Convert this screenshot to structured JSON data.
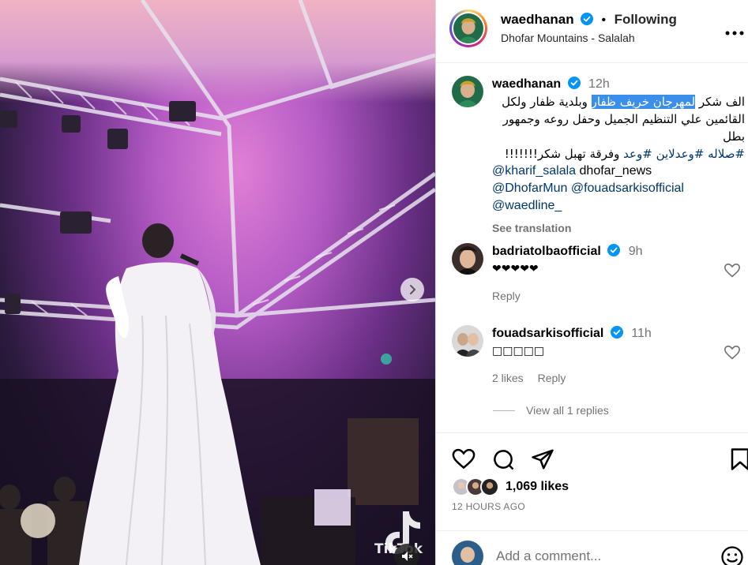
{
  "post": {
    "username": "waedhanan",
    "follow_status": "Following",
    "separator": "•",
    "location": "Dhofar Mountains - Salalah",
    "more_icon": "more-horizontal-icon"
  },
  "caption": {
    "username": "waedhanan",
    "time": "12h",
    "text_line1_pre": "الف شكر ",
    "text_line1_highlight": "لمهرجان خريف ظفار",
    "text_line1_post": " وبلدية ظفار ولكل",
    "text_line2": "القائمين علي التنظيم الجميل وحفل روعه وجمهور بطل",
    "text_line3_tags": "#صلاله #وعدلاين #وعد",
    "text_line3_text": " وفرقة تهبل شكر!!!!!!!",
    "mentions_line1_a": "@kharif_salala",
    "mentions_line1_b": " dhofar_news",
    "mentions_line2_a": "@DhofarMun",
    "mentions_line2_b": "@fouadsarkisofficial",
    "mentions_line3": "@waedline_",
    "see_translation": "See translation"
  },
  "comments": [
    {
      "username": "badriatolbaofficial",
      "time": "9h",
      "text": "❤❤❤❤❤",
      "likes": "",
      "reply": "Reply"
    },
    {
      "username": "fouadsarkisofficial",
      "time": "11h",
      "text": "□□□□□",
      "likes": "2 likes",
      "reply": "Reply"
    }
  ],
  "view_replies": "View all 1 replies",
  "actions": {
    "likes_count": "1,069 likes",
    "time_ago": "12 HOURS AGO"
  },
  "add_comment": {
    "placeholder": "Add a comment..."
  },
  "media": {
    "watermark": "TikTok"
  },
  "colors": {
    "verified": "#0095f6",
    "link": "#00376b",
    "muted": "#737373",
    "highlight": "#3b8eea"
  }
}
